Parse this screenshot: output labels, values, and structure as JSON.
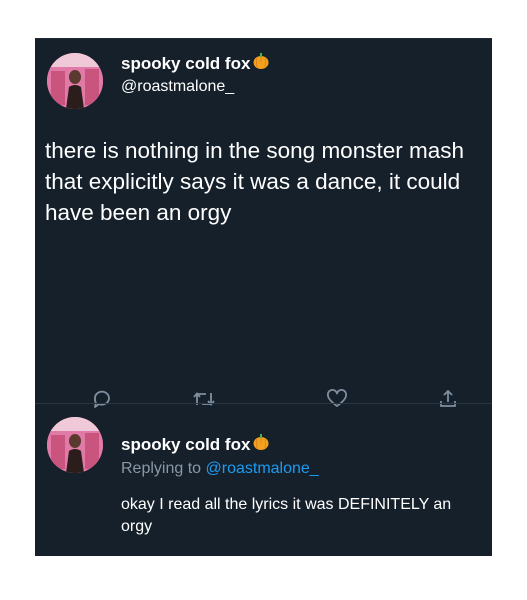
{
  "tweet": {
    "author_name": "spooky cold fox",
    "author_handle": "@roastmalone_",
    "text": "there is nothing in the song monster mash that explicitly says it was a dance, it could have been an orgy"
  },
  "actions": [
    {
      "icon": "reply-icon"
    },
    {
      "icon": "retweet-icon"
    },
    {
      "icon": "like-icon"
    },
    {
      "icon": "share-icon"
    }
  ],
  "reply": {
    "author_name": "spooky cold fox",
    "replying_prefix": "Replying to ",
    "replying_to": "@roastmalone_",
    "text": "okay I read all the lyrics it was DEFINITELY an orgy"
  },
  "colors": {
    "background": "#15202b",
    "text": "#ffffff",
    "muted": "#8899a6",
    "link": "#1d9bf0",
    "icon": "#7f8fa0",
    "pumpkin": "#f4a21d"
  }
}
